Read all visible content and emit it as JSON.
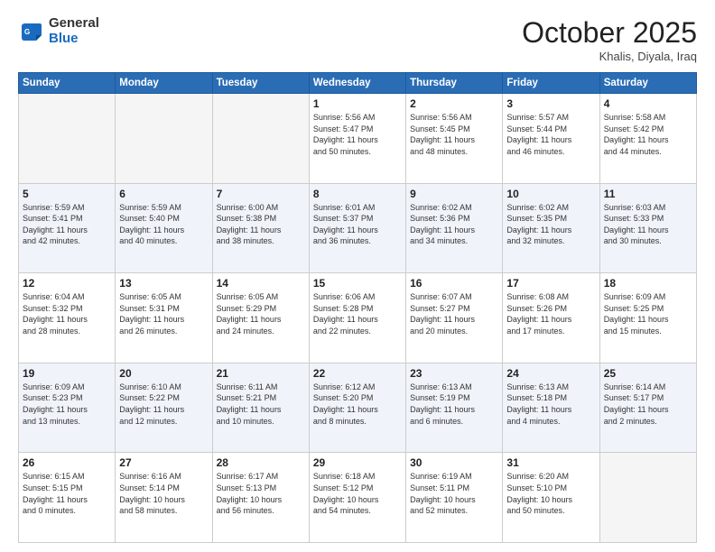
{
  "header": {
    "logo_general": "General",
    "logo_blue": "Blue",
    "month_title": "October 2025",
    "location": "Khalis, Diyala, Iraq"
  },
  "days_of_week": [
    "Sunday",
    "Monday",
    "Tuesday",
    "Wednesday",
    "Thursday",
    "Friday",
    "Saturday"
  ],
  "weeks": [
    [
      {
        "day": "",
        "detail": ""
      },
      {
        "day": "",
        "detail": ""
      },
      {
        "day": "",
        "detail": ""
      },
      {
        "day": "1",
        "detail": "Sunrise: 5:56 AM\nSunset: 5:47 PM\nDaylight: 11 hours\nand 50 minutes."
      },
      {
        "day": "2",
        "detail": "Sunrise: 5:56 AM\nSunset: 5:45 PM\nDaylight: 11 hours\nand 48 minutes."
      },
      {
        "day": "3",
        "detail": "Sunrise: 5:57 AM\nSunset: 5:44 PM\nDaylight: 11 hours\nand 46 minutes."
      },
      {
        "day": "4",
        "detail": "Sunrise: 5:58 AM\nSunset: 5:42 PM\nDaylight: 11 hours\nand 44 minutes."
      }
    ],
    [
      {
        "day": "5",
        "detail": "Sunrise: 5:59 AM\nSunset: 5:41 PM\nDaylight: 11 hours\nand 42 minutes."
      },
      {
        "day": "6",
        "detail": "Sunrise: 5:59 AM\nSunset: 5:40 PM\nDaylight: 11 hours\nand 40 minutes."
      },
      {
        "day": "7",
        "detail": "Sunrise: 6:00 AM\nSunset: 5:38 PM\nDaylight: 11 hours\nand 38 minutes."
      },
      {
        "day": "8",
        "detail": "Sunrise: 6:01 AM\nSunset: 5:37 PM\nDaylight: 11 hours\nand 36 minutes."
      },
      {
        "day": "9",
        "detail": "Sunrise: 6:02 AM\nSunset: 5:36 PM\nDaylight: 11 hours\nand 34 minutes."
      },
      {
        "day": "10",
        "detail": "Sunrise: 6:02 AM\nSunset: 5:35 PM\nDaylight: 11 hours\nand 32 minutes."
      },
      {
        "day": "11",
        "detail": "Sunrise: 6:03 AM\nSunset: 5:33 PM\nDaylight: 11 hours\nand 30 minutes."
      }
    ],
    [
      {
        "day": "12",
        "detail": "Sunrise: 6:04 AM\nSunset: 5:32 PM\nDaylight: 11 hours\nand 28 minutes."
      },
      {
        "day": "13",
        "detail": "Sunrise: 6:05 AM\nSunset: 5:31 PM\nDaylight: 11 hours\nand 26 minutes."
      },
      {
        "day": "14",
        "detail": "Sunrise: 6:05 AM\nSunset: 5:29 PM\nDaylight: 11 hours\nand 24 minutes."
      },
      {
        "day": "15",
        "detail": "Sunrise: 6:06 AM\nSunset: 5:28 PM\nDaylight: 11 hours\nand 22 minutes."
      },
      {
        "day": "16",
        "detail": "Sunrise: 6:07 AM\nSunset: 5:27 PM\nDaylight: 11 hours\nand 20 minutes."
      },
      {
        "day": "17",
        "detail": "Sunrise: 6:08 AM\nSunset: 5:26 PM\nDaylight: 11 hours\nand 17 minutes."
      },
      {
        "day": "18",
        "detail": "Sunrise: 6:09 AM\nSunset: 5:25 PM\nDaylight: 11 hours\nand 15 minutes."
      }
    ],
    [
      {
        "day": "19",
        "detail": "Sunrise: 6:09 AM\nSunset: 5:23 PM\nDaylight: 11 hours\nand 13 minutes."
      },
      {
        "day": "20",
        "detail": "Sunrise: 6:10 AM\nSunset: 5:22 PM\nDaylight: 11 hours\nand 12 minutes."
      },
      {
        "day": "21",
        "detail": "Sunrise: 6:11 AM\nSunset: 5:21 PM\nDaylight: 11 hours\nand 10 minutes."
      },
      {
        "day": "22",
        "detail": "Sunrise: 6:12 AM\nSunset: 5:20 PM\nDaylight: 11 hours\nand 8 minutes."
      },
      {
        "day": "23",
        "detail": "Sunrise: 6:13 AM\nSunset: 5:19 PM\nDaylight: 11 hours\nand 6 minutes."
      },
      {
        "day": "24",
        "detail": "Sunrise: 6:13 AM\nSunset: 5:18 PM\nDaylight: 11 hours\nand 4 minutes."
      },
      {
        "day": "25",
        "detail": "Sunrise: 6:14 AM\nSunset: 5:17 PM\nDaylight: 11 hours\nand 2 minutes."
      }
    ],
    [
      {
        "day": "26",
        "detail": "Sunrise: 6:15 AM\nSunset: 5:15 PM\nDaylight: 11 hours\nand 0 minutes."
      },
      {
        "day": "27",
        "detail": "Sunrise: 6:16 AM\nSunset: 5:14 PM\nDaylight: 10 hours\nand 58 minutes."
      },
      {
        "day": "28",
        "detail": "Sunrise: 6:17 AM\nSunset: 5:13 PM\nDaylight: 10 hours\nand 56 minutes."
      },
      {
        "day": "29",
        "detail": "Sunrise: 6:18 AM\nSunset: 5:12 PM\nDaylight: 10 hours\nand 54 minutes."
      },
      {
        "day": "30",
        "detail": "Sunrise: 6:19 AM\nSunset: 5:11 PM\nDaylight: 10 hours\nand 52 minutes."
      },
      {
        "day": "31",
        "detail": "Sunrise: 6:20 AM\nSunset: 5:10 PM\nDaylight: 10 hours\nand 50 minutes."
      },
      {
        "day": "",
        "detail": ""
      }
    ]
  ]
}
